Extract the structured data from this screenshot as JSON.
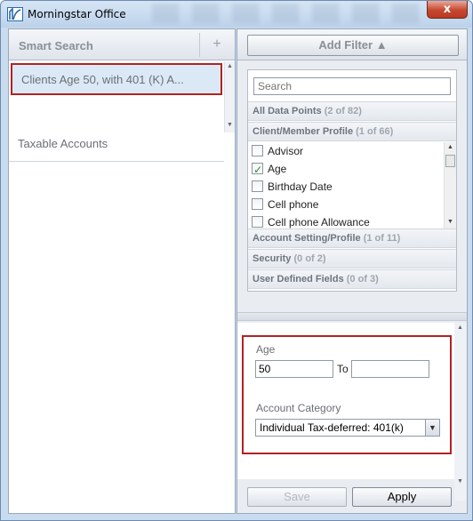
{
  "window": {
    "title": "Morningstar Office",
    "close_label": "x"
  },
  "left": {
    "header_title": "Smart Search",
    "add_label": "+",
    "searches": [
      {
        "label": "Clients Age 50, with 401 (K) A..."
      },
      {
        "label": "Taxable  Accounts"
      }
    ]
  },
  "right": {
    "add_filter_label": "Add Filter ▲",
    "search_placeholder": "Search",
    "sections": {
      "all": {
        "name": "All Data Points",
        "count": "(2 of 82)"
      },
      "client": {
        "name": "Client/Member Profile",
        "count": "(1 of 66)"
      },
      "account": {
        "name": "Account Setting/Profile",
        "count": "(1 of 11)"
      },
      "security": {
        "name": "Security",
        "count": "(0 of 2)"
      },
      "user": {
        "name": "User Defined Fields",
        "count": "(0 of 3)"
      }
    },
    "fields": [
      {
        "label": "Advisor",
        "checked": false
      },
      {
        "label": "Age",
        "checked": true
      },
      {
        "label": "Birthday Date",
        "checked": false
      },
      {
        "label": "Cell phone",
        "checked": false
      },
      {
        "label": "Cell phone Allowance",
        "checked": false
      }
    ],
    "criteria": {
      "age_label": "Age",
      "age_from": "50",
      "to_label": "To",
      "age_to": "",
      "category_label": "Account Category",
      "category_value": "Individual Tax-deferred: 401(k)"
    },
    "save_label": "Save",
    "apply_label": "Apply"
  },
  "colors": {
    "highlight_border": "#b22222",
    "selected_bg": "#dbe9f7",
    "window_frame": "#c9dbee"
  }
}
